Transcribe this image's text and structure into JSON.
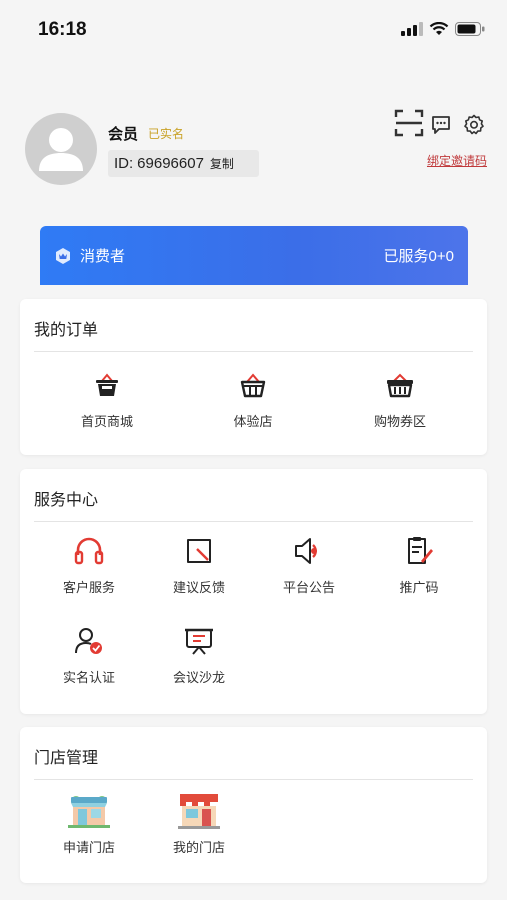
{
  "status_bar": {
    "time": "16:18"
  },
  "profile": {
    "name": "会员",
    "verified": "已实名",
    "id_prefix": "ID:",
    "id_value": "69696607",
    "copy_label": "复制",
    "bind_invite_label": "绑定邀请码"
  },
  "consumer_banner": {
    "role": "消费者",
    "service_stats": "已服务0+0"
  },
  "orders": {
    "title": "我的订单",
    "items": [
      {
        "label": "首页商城",
        "icon": "basket-icon"
      },
      {
        "label": "体验店",
        "icon": "basket-icon"
      },
      {
        "label": "购物券区",
        "icon": "basket-icon"
      }
    ]
  },
  "service_center": {
    "title": "服务中心",
    "items": [
      {
        "label": "客户服务",
        "icon": "headset-icon"
      },
      {
        "label": "建议反馈",
        "icon": "feedback-icon"
      },
      {
        "label": "平台公告",
        "icon": "speaker-icon"
      },
      {
        "label": "推广码",
        "icon": "document-edit-icon"
      },
      {
        "label": "实名认证",
        "icon": "user-verified-icon"
      },
      {
        "label": "会议沙龙",
        "icon": "presentation-icon"
      }
    ]
  },
  "store_management": {
    "title": "门店管理",
    "items": [
      {
        "label": "申请门店",
        "icon": "store-icon"
      },
      {
        "label": "我的门店",
        "icon": "storefront-icon"
      }
    ]
  },
  "colors": {
    "accent_red": "#e23b33",
    "banner_blue": "#2f7bf5",
    "verified_gold": "#c9a227"
  }
}
